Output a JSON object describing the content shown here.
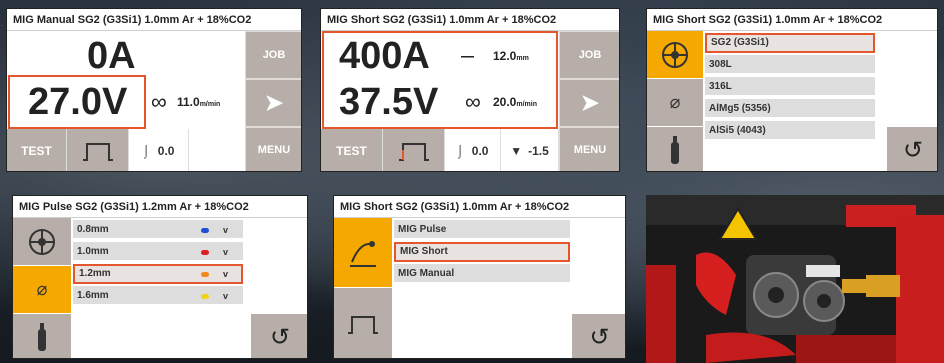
{
  "panel1": {
    "title": "MIG Manual  SG2 (G3Si1)  1.0mm  Ar + 18%CO2",
    "current": "0A",
    "voltage": "27.0V",
    "wire_speed": "11.0",
    "wire_speed_unit": "m/min",
    "job_label": "JOB",
    "menu_label": "MENU",
    "test_label": "TEST",
    "inductance": "0.0"
  },
  "panel2": {
    "title": "MIG Short  SG2 (G3Si1)  1.0mm  Ar + 18%CO2",
    "current": "400A",
    "thickness": "12.0",
    "thickness_unit": "mm",
    "voltage": "37.5V",
    "wire_speed": "20.0",
    "wire_speed_unit": "m/min",
    "job_label": "JOB",
    "menu_label": "MENU",
    "test_label": "TEST",
    "inductance": "0.0",
    "arc_length": "-1.5"
  },
  "panel3": {
    "title": "MIG Short  SG2 (G3Si1)  1.0mm  Ar + 18%CO2",
    "materials": [
      "SG2 (G3Si1)",
      "308L",
      "316L",
      "AlMg5 (5356)",
      "AlSi5 (4043)"
    ],
    "selected_index": 0
  },
  "panel4": {
    "title": "MIG Pulse  SG2 (G3Si1)  1.2mm  Ar + 18%CO2",
    "diameters": [
      {
        "label": "0.8mm",
        "color": "#1f4fd6"
      },
      {
        "label": "1.0mm",
        "color": "#e02020"
      },
      {
        "label": "1.2mm",
        "color": "#f08a1c"
      },
      {
        "label": "1.6mm",
        "color": "#f2d21a"
      }
    ],
    "selected_index": 2,
    "chevron": "v"
  },
  "panel5": {
    "title": "MIG Short  SG2 (G3Si1)  1.0mm  Ar + 18%CO2",
    "modes": [
      "MIG Pulse",
      "MIG Short",
      "MIG Manual"
    ],
    "selected_index": 1
  },
  "colors": {
    "accent": "#e4572e",
    "active_tab": "#f5a800",
    "button_gray": "#b7aea9"
  }
}
